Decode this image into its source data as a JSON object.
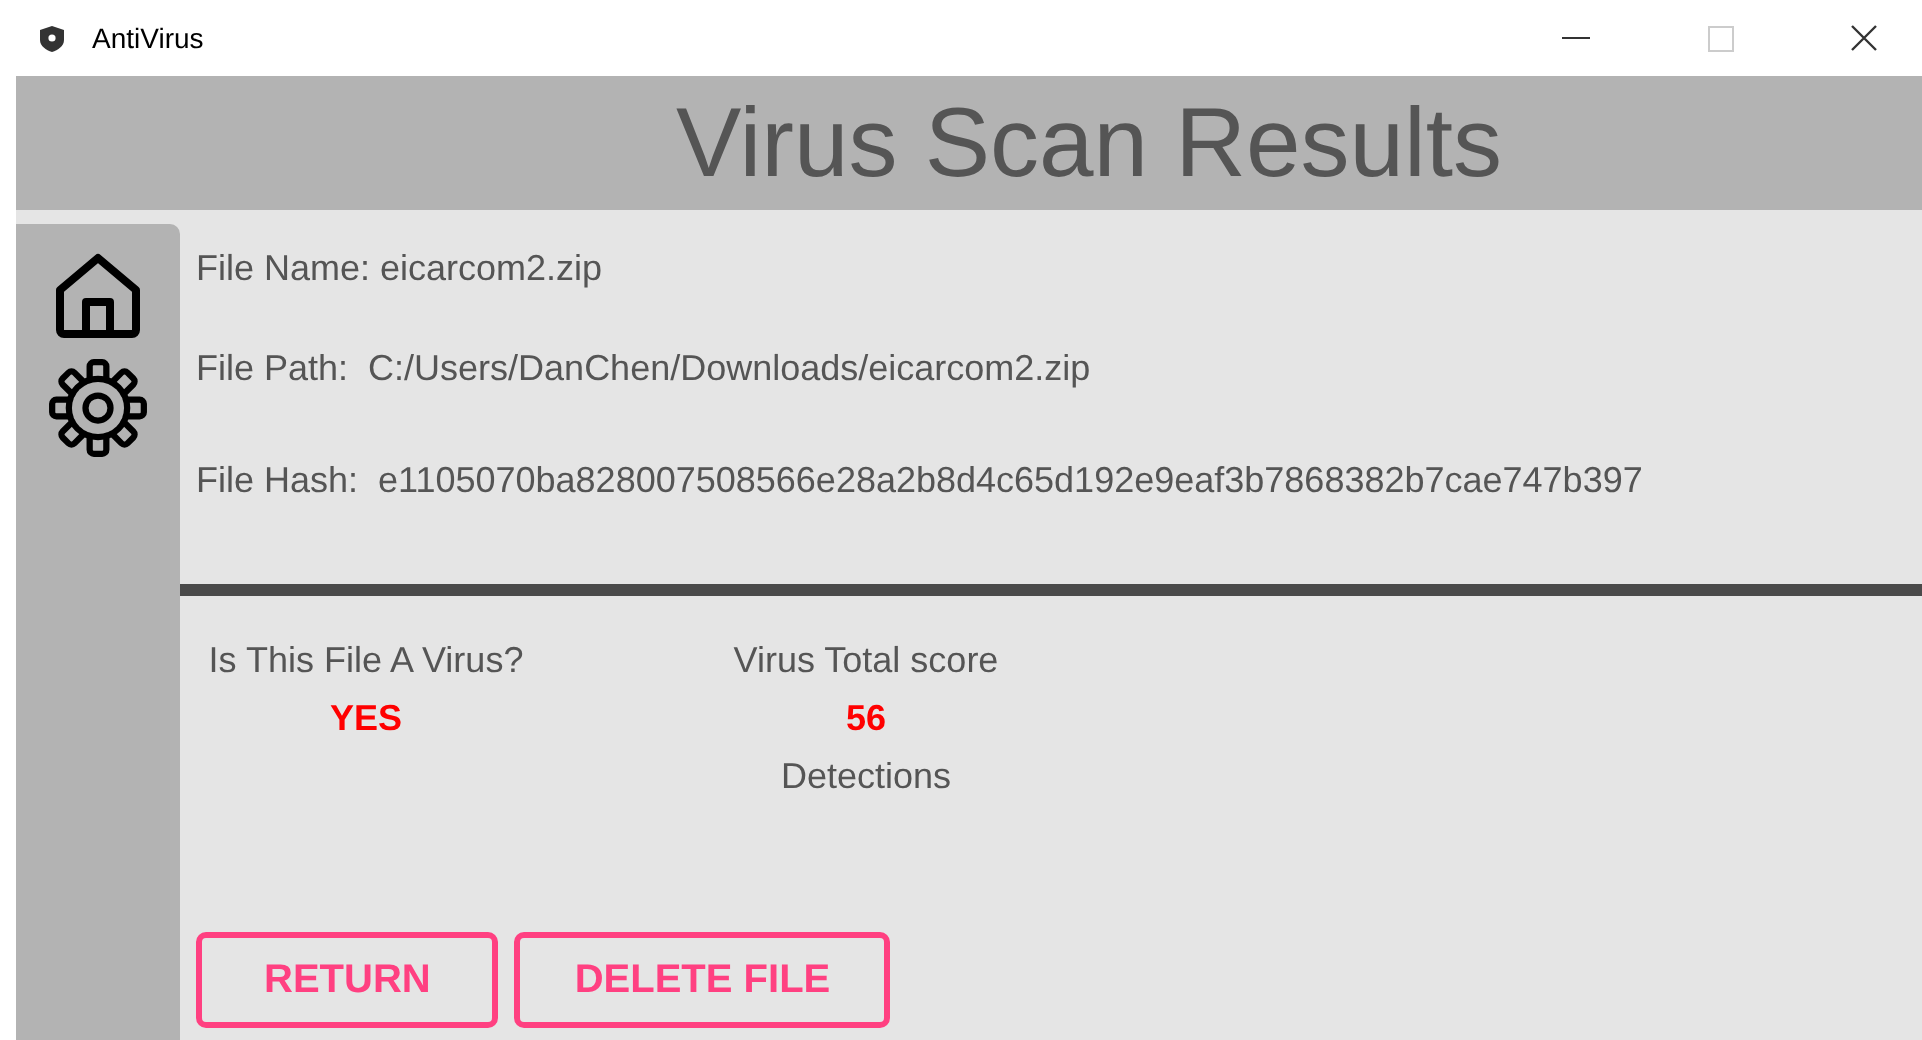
{
  "window": {
    "title": "AntiVirus"
  },
  "header": {
    "title": "Virus Scan Results"
  },
  "sidebar": {
    "items": [
      {
        "kind": "home"
      },
      {
        "kind": "settings"
      }
    ]
  },
  "file_info": [
    {
      "label": "File Name:",
      "value": "eicarcom2.zip"
    },
    {
      "label": "File Path: ",
      "value": "C:/Users/DanChen/Downloads/eicarcom2.zip"
    },
    {
      "label": "File Hash: ",
      "value": "e1105070ba828007508566e28a2b8d4c65d192e9eaf3b7868382b7cae747b397"
    }
  ],
  "verdict": {
    "label": "Is This File A Virus?",
    "value": "YES"
  },
  "score": {
    "label": "Virus Total score",
    "value": "56",
    "unit": "Detections"
  },
  "buttons": [
    "RETURN",
    "DELETE FILE"
  ]
}
